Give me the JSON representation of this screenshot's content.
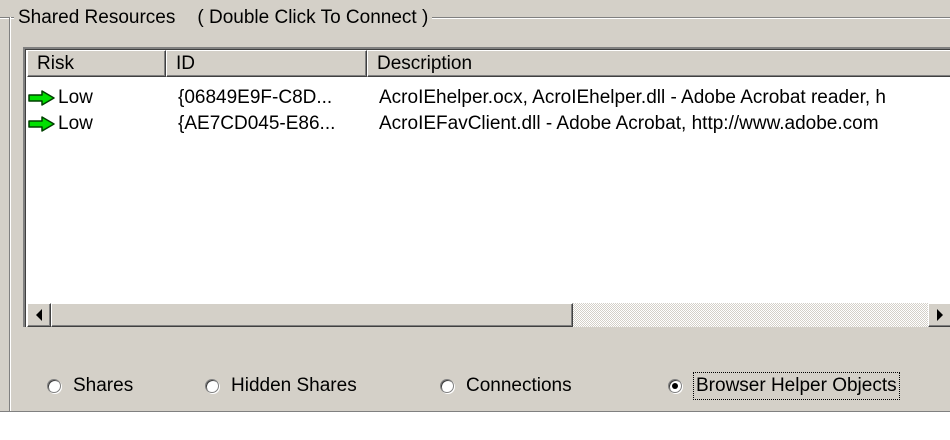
{
  "groupbox": {
    "title": "Shared Resources",
    "hint": "( Double Click To Connect )"
  },
  "listview": {
    "columns": [
      "Risk",
      "ID",
      "Description"
    ],
    "rows": [
      {
        "icon": "green-arrow-icon",
        "risk": "Low",
        "id": "{06849E9F-C8D...",
        "description": "AcroIEhelper.ocx, AcroIEhelper.dll - Adobe Acrobat reader, h"
      },
      {
        "icon": "green-arrow-icon",
        "risk": "Low",
        "id": "{AE7CD045-E86...",
        "description": "AcroIEFavClient.dll - Adobe Acrobat, http://www.adobe.com"
      }
    ]
  },
  "radios": [
    {
      "label": "Shares",
      "checked": false
    },
    {
      "label": "Hidden Shares",
      "checked": false
    },
    {
      "label": "Connections",
      "checked": false
    },
    {
      "label": "Browser Helper Objects",
      "checked": true
    }
  ],
  "colors": {
    "face": "#d4d0c8",
    "arrow_fill": "#00e000",
    "arrow_outline": "#004000"
  }
}
